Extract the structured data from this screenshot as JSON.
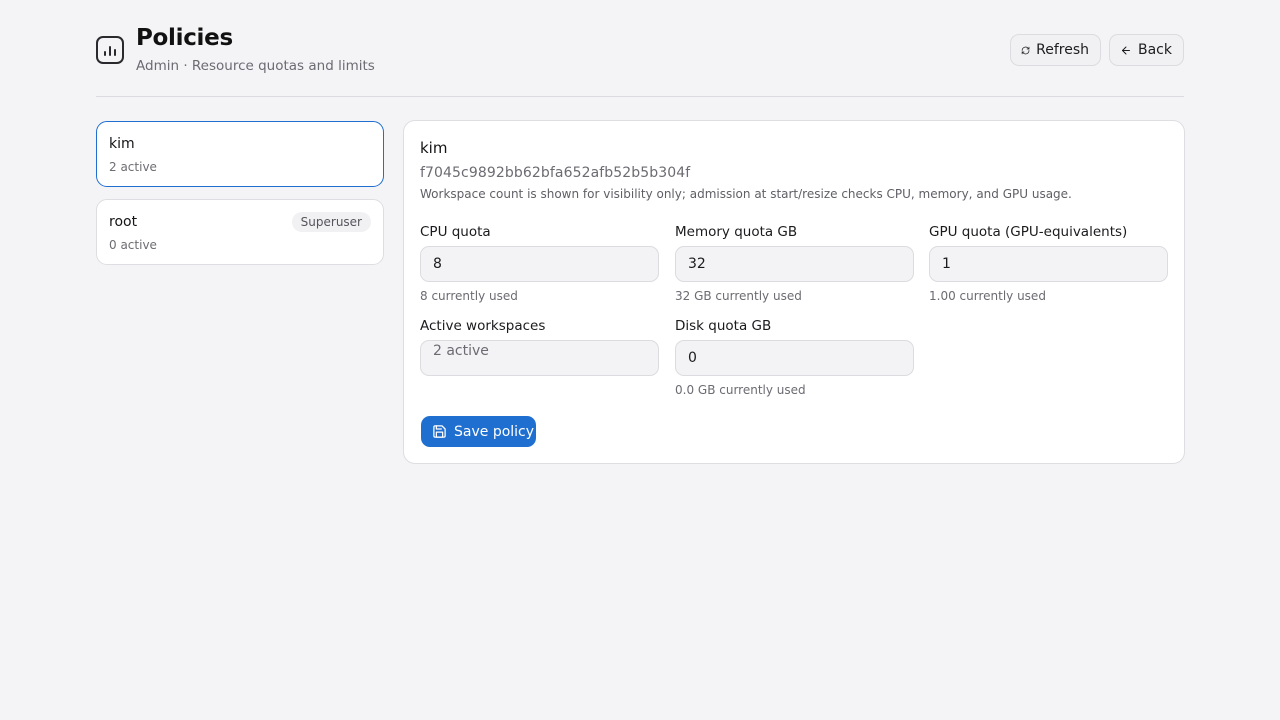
{
  "header": {
    "title": "Policies",
    "subtitle": "Admin · Resource quotas and limits",
    "refresh_label": "Refresh",
    "back_label": "Back"
  },
  "users": [
    {
      "name": "kim",
      "count": "2 active",
      "badge": "",
      "selected": true
    },
    {
      "name": "root",
      "count": "0 active",
      "badge": "Superuser",
      "selected": false
    }
  ],
  "detail": {
    "name": "kim",
    "id": "f7045c9892bb62bfa652afb52b5b304f",
    "note": "Workspace count is shown for visibility only; admission at start/resize checks CPU, memory, and GPU usage.",
    "fields": {
      "cpu": {
        "label": "CPU quota",
        "value": "8",
        "hint": "8 currently used"
      },
      "memory": {
        "label": "Memory quota GB",
        "value": "32",
        "hint": "32 GB currently used"
      },
      "gpu": {
        "label": "GPU quota (GPU-equivalents)",
        "value": "1",
        "hint": "1.00 currently used"
      },
      "workspaces": {
        "label": "Active workspaces",
        "value": "2 active"
      },
      "disk": {
        "label": "Disk quota GB",
        "value": "0",
        "hint": "0.0 GB currently used"
      }
    },
    "save_label": "Save policy"
  },
  "icons": {
    "logo": "bar-chart-icon",
    "refresh": "refresh-icon",
    "back": "arrow-left-icon",
    "save": "floppy-disk-icon"
  },
  "colors": {
    "accent": "#1f6fd1",
    "background": "#f4f4f6"
  }
}
